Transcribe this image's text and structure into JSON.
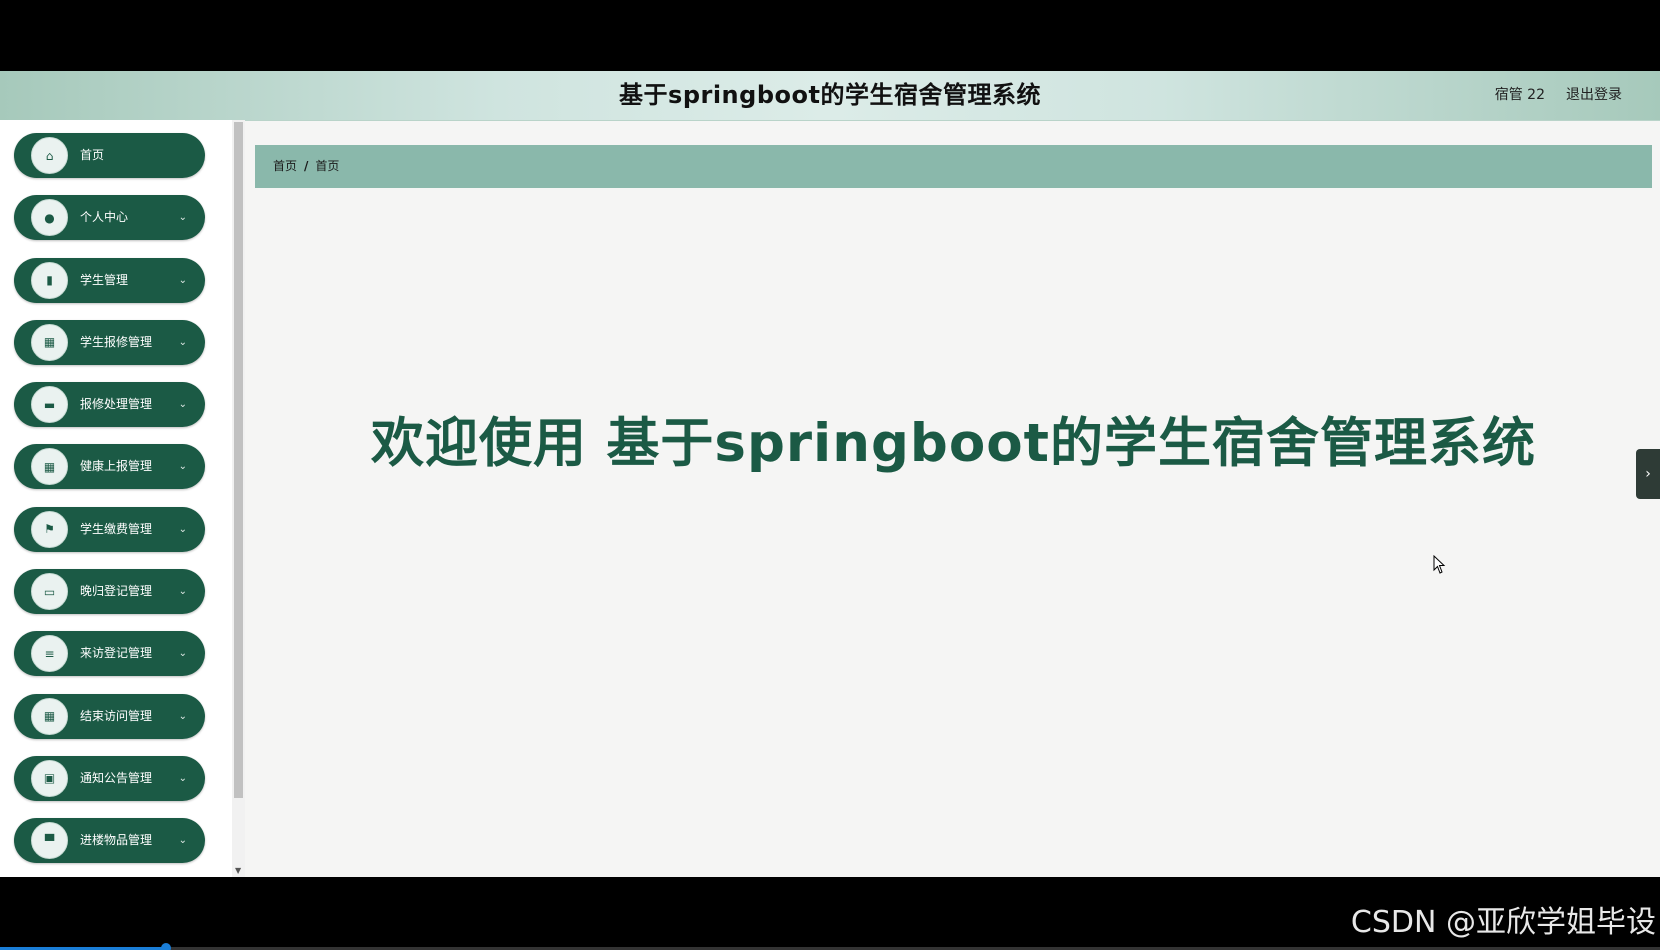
{
  "header": {
    "title": "基于springboot的学生宿舍管理系统",
    "user": "宿管 22",
    "logout": "退出登录"
  },
  "sidebar": {
    "items": [
      {
        "label": "首页",
        "icon": "home-icon",
        "glyph": "⌂",
        "has_chevron": false
      },
      {
        "label": "个人中心",
        "icon": "user-icon",
        "glyph": "●",
        "has_chevron": true
      },
      {
        "label": "学生管理",
        "icon": "book-icon",
        "glyph": "▮",
        "has_chevron": true
      },
      {
        "label": "学生报修管理",
        "icon": "grid-icon",
        "glyph": "▦",
        "has_chevron": true
      },
      {
        "label": "报修处理管理",
        "icon": "briefcase-icon",
        "glyph": "▬",
        "has_chevron": true
      },
      {
        "label": "健康上报管理",
        "icon": "grid-icon",
        "glyph": "▦",
        "has_chevron": true
      },
      {
        "label": "学生缴费管理",
        "icon": "flag-icon",
        "glyph": "⚑",
        "has_chevron": true
      },
      {
        "label": "晚归登记管理",
        "icon": "message-icon",
        "glyph": "▭",
        "has_chevron": true
      },
      {
        "label": "来访登记管理",
        "icon": "list-icon",
        "glyph": "≡",
        "has_chevron": true
      },
      {
        "label": "结束访问管理",
        "icon": "grid-icon",
        "glyph": "▦",
        "has_chevron": true
      },
      {
        "label": "通知公告管理",
        "icon": "clipboard-icon",
        "glyph": "▣",
        "has_chevron": true
      },
      {
        "label": "进楼物品管理",
        "icon": "monitor-icon",
        "glyph": "▀",
        "has_chevron": true
      }
    ],
    "chevron": "⌄"
  },
  "breadcrumb": {
    "root": "首页",
    "separator": "/",
    "current": "首页"
  },
  "main": {
    "welcome": "欢迎使用 基于springboot的学生宿舍管理系统"
  },
  "side_tab": {
    "glyph": "›"
  },
  "watermark": "CSDN @亚欣学姐毕设",
  "taskbar": {
    "progress": 0.1
  },
  "colors": {
    "primary": "#1b5a45",
    "breadcrumb_bg": "#8ab8ab",
    "content_bg": "#f5f5f4"
  }
}
